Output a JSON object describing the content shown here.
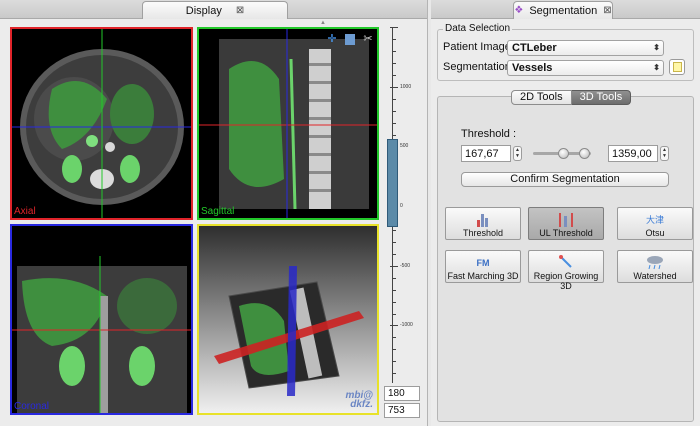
{
  "left_panel": {
    "tab_title": "Display",
    "tab_close": "⊠",
    "views": {
      "axial_label": "Axial",
      "sagittal_label": "Sagittal",
      "coronal_label": "Coronal"
    },
    "logo_line1": "mbi@",
    "logo_line2": "dkfz.",
    "level_window": {
      "tick_labels": [
        "1000",
        "500",
        "0",
        "-500",
        "-1000"
      ],
      "level": "180",
      "window": "753"
    }
  },
  "right_panel": {
    "tab_title": "Segmentation",
    "tab_close": "⊠",
    "data_selection": {
      "title": "Data Selection",
      "patient_image_label": "Patient Image",
      "patient_image_value": "CTLeber",
      "segmentation_label": "Segmentation",
      "segmentation_value": "Vessels"
    },
    "tabs": [
      "2D Tools",
      "3D Tools"
    ],
    "active_tab": "3D Tools",
    "threshold": {
      "label": "Threshold :",
      "lower": "167,67",
      "upper": "1359,00",
      "confirm_label": "Confirm Segmentation"
    },
    "tools": [
      {
        "label": "Threshold",
        "icon": "threshold-histogram-icon",
        "active": false
      },
      {
        "label": "UL Threshold",
        "icon": "ul-threshold-icon",
        "active": true
      },
      {
        "label": "Otsu",
        "icon": "otsu-icon",
        "active": false
      },
      {
        "label": "Fast Marching 3D",
        "icon": "fast-marching-icon",
        "active": false
      },
      {
        "label": "Region Growing 3D",
        "icon": "region-growing-icon",
        "active": false
      },
      {
        "label": "Watershed",
        "icon": "watershed-icon",
        "active": false
      }
    ],
    "otsu_glyph": "大津",
    "fm_glyph": "FM"
  }
}
